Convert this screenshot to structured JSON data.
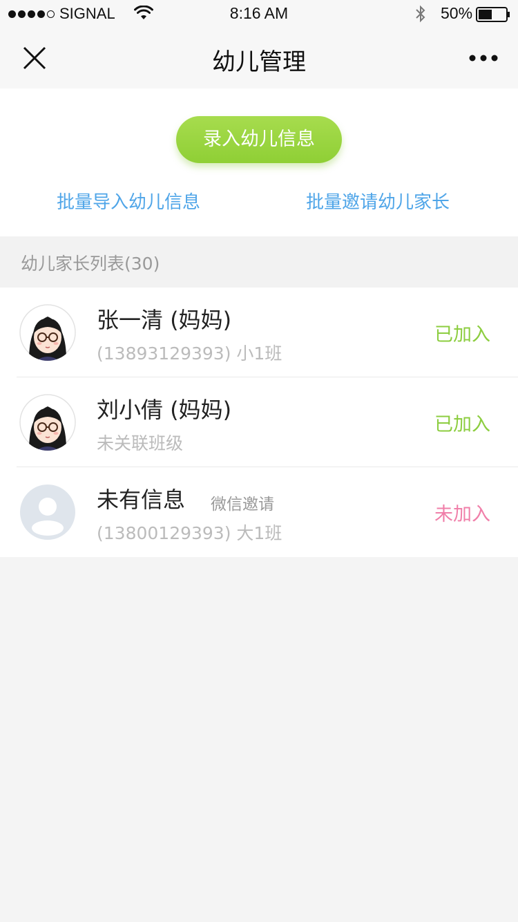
{
  "status_bar": {
    "carrier": "SIGNAL",
    "time": "8:16 AM",
    "battery": "50%",
    "signal_dots": 5,
    "signal_filled": 4,
    "battery_level": 0.5
  },
  "nav": {
    "title": "幼儿管理",
    "close_icon": "close-icon",
    "more_icon": "more-icon"
  },
  "actions": {
    "primary_label": "录入幼儿信息",
    "import_label": "批量导入幼儿信息",
    "invite_label": "批量邀请幼儿家长"
  },
  "list": {
    "header": "幼儿家长列表(30)",
    "items": [
      {
        "name": "张一清 (妈妈)",
        "tag": "",
        "sub": "(13893129393) 小1班",
        "status": "已加入",
        "avatar": "girl-avatar"
      },
      {
        "name": "刘小倩 (妈妈)",
        "tag": "",
        "sub": "未关联班级",
        "status": "已加入",
        "avatar": "girl-avatar"
      },
      {
        "name": "未有信息",
        "tag": "微信邀请",
        "sub": "(13800129393) 大1班",
        "status": "未加入",
        "avatar": "default-avatar"
      }
    ]
  },
  "colors": {
    "accent_green": "#8fcf35",
    "link_blue": "#4fa5e8",
    "joined_green": "#8ccd3f",
    "not_joined_pink": "#f07fa9"
  }
}
